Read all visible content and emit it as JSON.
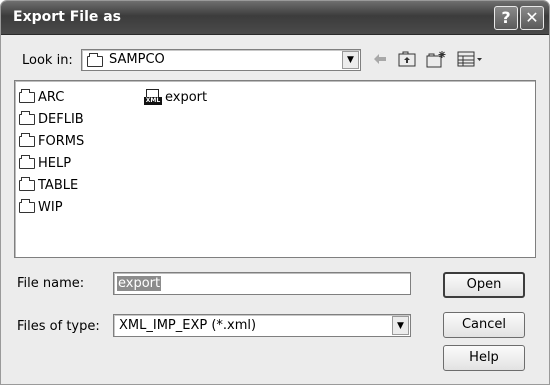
{
  "window": {
    "title": "Export File as",
    "help_symbol": "?",
    "close_symbol": "✕"
  },
  "look_in": {
    "label": "Look in:",
    "value": "SAMPCO"
  },
  "toolbar": {
    "back_icon": "back-arrow-icon",
    "up_icon": "up-folder-icon",
    "new_folder_icon": "new-folder-icon",
    "view_icon": "view-menu-icon"
  },
  "folders": [
    "ARC",
    "DEFLIB",
    "FORMS",
    "HELP",
    "TABLE",
    "WIP"
  ],
  "files": [
    {
      "name": "export",
      "badge": "XML",
      "icon": "xml-file-icon"
    }
  ],
  "file_name": {
    "label": "File name:",
    "value": "export"
  },
  "file_type": {
    "label": "Files of type:",
    "value": "XML_IMP_EXP (*.xml)"
  },
  "buttons": {
    "open": "Open",
    "cancel": "Cancel",
    "help": "Help"
  }
}
